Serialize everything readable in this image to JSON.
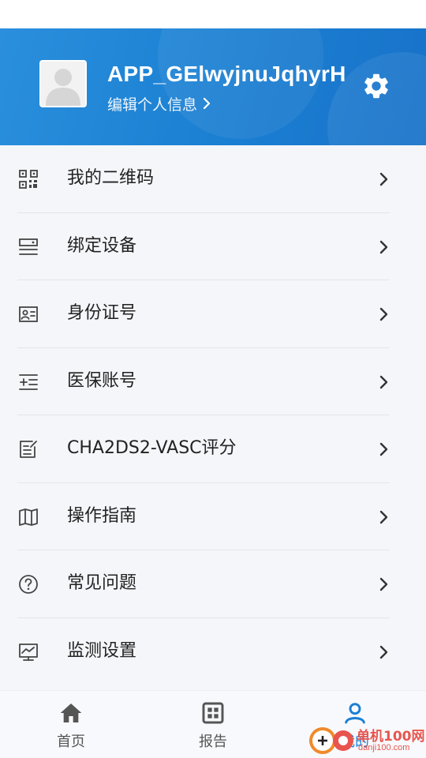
{
  "profile": {
    "username": "APP_GElwyjnuJqhyrH",
    "edit_label": "编辑个人信息"
  },
  "colors": {
    "header_blue": "#1b7fd2",
    "active_tab": "#1a7fd4",
    "text_primary": "#222222",
    "divider": "#e3e5ea"
  },
  "menu": {
    "items": [
      {
        "label": "我的二维码",
        "icon": "qr-code-icon"
      },
      {
        "label": "绑定设备",
        "icon": "device-icon"
      },
      {
        "label": "身份证号",
        "icon": "id-card-icon"
      },
      {
        "label": "医保账号",
        "icon": "medical-insurance-icon"
      },
      {
        "label": "CHA2DS2-VASC评分",
        "icon": "score-form-icon"
      },
      {
        "label": "操作指南",
        "icon": "guide-map-icon"
      },
      {
        "label": "常见问题",
        "icon": "question-icon"
      },
      {
        "label": "监测设置",
        "icon": "monitor-icon"
      }
    ]
  },
  "tabbar": {
    "tabs": [
      {
        "label": "首页",
        "icon": "home-icon",
        "active": false
      },
      {
        "label": "报告",
        "icon": "report-grid-icon",
        "active": false
      },
      {
        "label": "我的",
        "icon": "user-icon",
        "active": true
      }
    ]
  },
  "watermark": {
    "brand": "单机100网",
    "url": "danji100.com"
  }
}
